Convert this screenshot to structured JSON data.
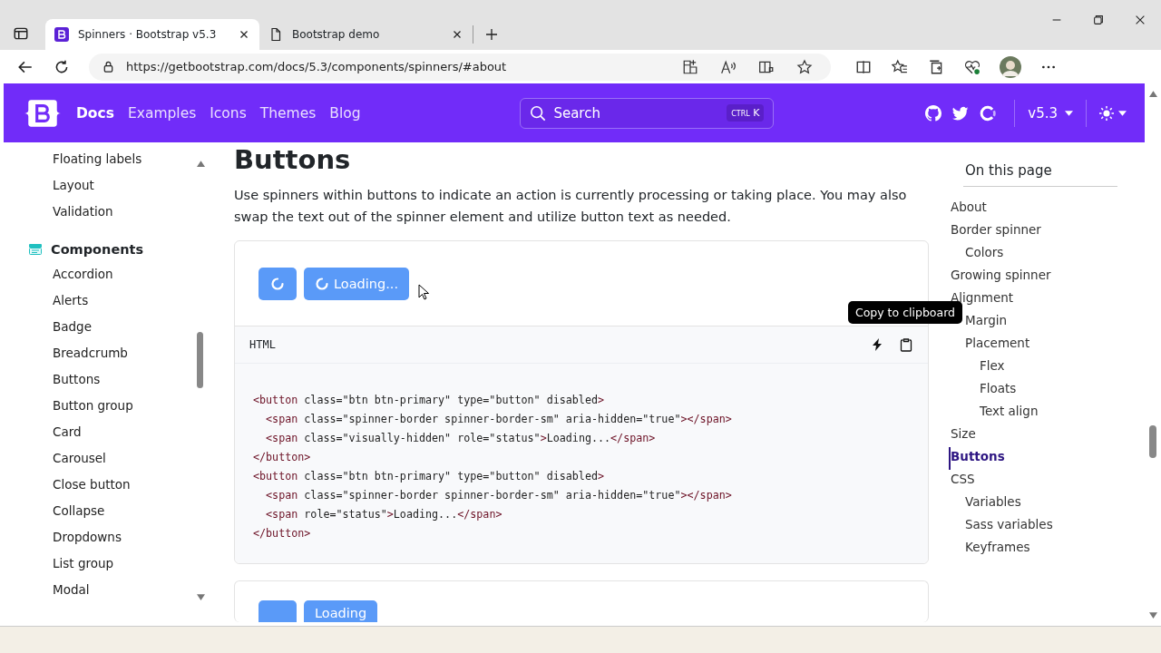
{
  "browser": {
    "tabs": [
      {
        "title": "Spinners · Bootstrap v5.3",
        "kind": "bootstrap",
        "selected": true
      },
      {
        "title": "Bootstrap demo",
        "kind": "page",
        "selected": false
      }
    ],
    "url": "https://getbootstrap.com/docs/5.3/components/spinners/#about"
  },
  "navbar": {
    "links": [
      {
        "label": "Docs",
        "selected": true
      },
      {
        "label": "Examples",
        "selected": false
      },
      {
        "label": "Icons",
        "selected": false
      },
      {
        "label": "Themes",
        "selected": false
      },
      {
        "label": "Blog",
        "selected": false
      }
    ],
    "search": {
      "placeholder": "Search",
      "shortcut_modifier": "CTRL",
      "shortcut_key": "K"
    },
    "version": "v5.3"
  },
  "sidebar": {
    "groups": [
      {
        "items": [
          "Floating labels",
          "Layout",
          "Validation"
        ]
      },
      {
        "title": "Components",
        "items": [
          "Accordion",
          "Alerts",
          "Badge",
          "Breadcrumb",
          "Buttons",
          "Button group",
          "Card",
          "Carousel",
          "Close button",
          "Collapse",
          "Dropdowns",
          "List group",
          "Modal"
        ]
      }
    ]
  },
  "content": {
    "heading": "Buttons",
    "paragraph": "Use spinners within buttons to indicate an action is currently processing or taking place. You may also swap the text out of the spinner element and utilize button text as needed.",
    "example": {
      "button_label": "Loading...",
      "code_language": "HTML",
      "tooltip": "Copy to clipboard",
      "code": [
        "<button class=\"btn btn-primary\" type=\"button\" disabled>",
        "  <span class=\"spinner-border spinner-border-sm\" aria-hidden=\"true\"></span>",
        "  <span class=\"visually-hidden\" role=\"status\">Loading...</span>",
        "</button>",
        "<button class=\"btn btn-primary\" type=\"button\" disabled>",
        "  <span class=\"spinner-border spinner-border-sm\" aria-hidden=\"true\"></span>",
        "  <span role=\"status\">Loading...</span>",
        "</button>"
      ]
    },
    "next_example": {
      "button_label": "Loading"
    }
  },
  "toc": {
    "title": "On this page",
    "items": [
      {
        "label": "About",
        "selected": false
      },
      {
        "label": "Border spinner",
        "selected": false,
        "children": [
          {
            "label": "Colors",
            "selected": false
          }
        ]
      },
      {
        "label": "Growing spinner",
        "selected": false
      },
      {
        "label": "Alignment",
        "selected": false,
        "children": [
          {
            "label": "Margin",
            "selected": false
          },
          {
            "label": "Placement",
            "selected": false,
            "children": [
              {
                "label": "Flex",
                "selected": false
              },
              {
                "label": "Floats",
                "selected": false
              },
              {
                "label": "Text align",
                "selected": false
              }
            ]
          }
        ]
      },
      {
        "label": "Size",
        "selected": false
      },
      {
        "label": "Buttons",
        "selected": true
      },
      {
        "label": "CSS",
        "selected": false,
        "children": [
          {
            "label": "Variables",
            "selected": false
          },
          {
            "label": "Sass variables",
            "selected": false
          },
          {
            "label": "Keyframes",
            "selected": false
          }
        ]
      }
    ]
  }
}
